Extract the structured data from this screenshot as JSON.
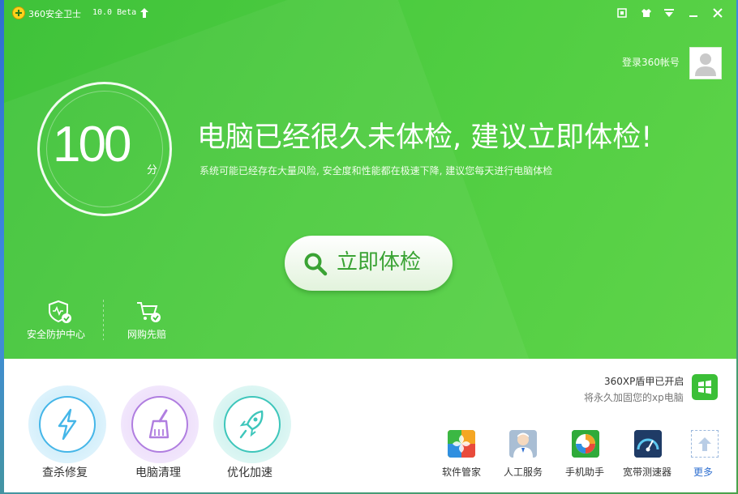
{
  "window": {
    "title": "360安全卫士",
    "version": "10.0 Beta"
  },
  "account": {
    "login_label": "登录360帐号"
  },
  "score": {
    "value": "100",
    "unit": "分"
  },
  "status": {
    "headline": "电脑已经很久未体检, 建议立即体检!",
    "subline": "系统可能已经存在大量风险, 安全度和性能都在极速下降, 建议您每天进行电脑体检"
  },
  "scan_button": {
    "label": "立即体检"
  },
  "side_tools": [
    {
      "label": "安全防护中心"
    },
    {
      "label": "网购先赔"
    }
  ],
  "xp_shield": {
    "status": "360XP盾甲已开启",
    "description": "将永久加固您的xp电脑"
  },
  "main_tools": [
    {
      "label": "查杀修复",
      "color": "#45b6e8"
    },
    {
      "label": "电脑清理",
      "color": "#b07ee0"
    },
    {
      "label": "优化加速",
      "color": "#3ec6bb"
    }
  ],
  "apps": [
    {
      "label": "软件管家"
    },
    {
      "label": "人工服务"
    },
    {
      "label": "手机助手"
    },
    {
      "label": "宽带测速器"
    },
    {
      "label": "更多"
    }
  ],
  "colors": {
    "brand_green": "#4dcc40",
    "link_blue": "#2f6fd0"
  }
}
